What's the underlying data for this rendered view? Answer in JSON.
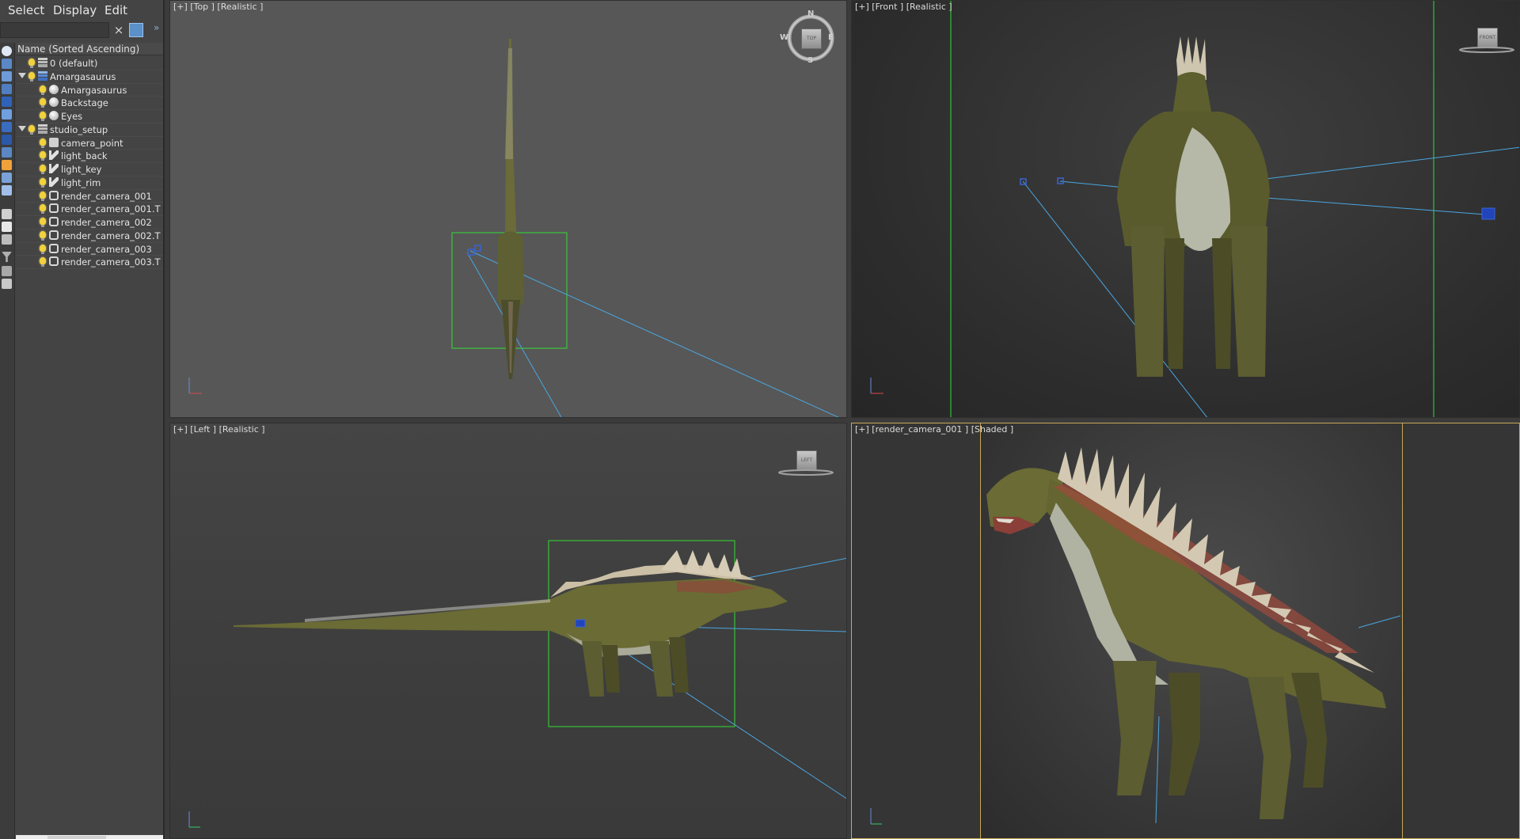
{
  "menu": {
    "select": "Select",
    "display": "Display",
    "edit": "Edit"
  },
  "search": {
    "value": "",
    "placeholder": "",
    "clear_icon": "×",
    "expand_icon": "»"
  },
  "explorer": {
    "column_header": "Name (Sorted Ascending)",
    "rows": [
      {
        "label": "0 (default)",
        "depth": 0,
        "icon": "layer-icon",
        "expander": false
      },
      {
        "label": "Amargasaurus",
        "depth": 0,
        "icon": "layer-icon",
        "expander": true
      },
      {
        "label": "Amargasaurus",
        "depth": 1,
        "icon": "geometry-icon",
        "expander": false
      },
      {
        "label": "Backstage",
        "depth": 1,
        "icon": "geometry-icon",
        "expander": false
      },
      {
        "label": "Eyes",
        "depth": 1,
        "icon": "geometry-icon",
        "expander": false
      },
      {
        "label": "studio_setup",
        "depth": 0,
        "icon": "layer-icon",
        "expander": true
      },
      {
        "label": "camera_point",
        "depth": 1,
        "icon": "point-icon",
        "expander": false
      },
      {
        "label": "light_back",
        "depth": 1,
        "icon": "light-icon",
        "expander": false
      },
      {
        "label": "light_key",
        "depth": 1,
        "icon": "light-icon",
        "expander": false
      },
      {
        "label": "light_rim",
        "depth": 1,
        "icon": "light-icon",
        "expander": false
      },
      {
        "label": "render_camera_001",
        "depth": 1,
        "icon": "camera-icon",
        "expander": false
      },
      {
        "label": "render_camera_001.T",
        "depth": 1,
        "icon": "camera-icon",
        "expander": false
      },
      {
        "label": "render_camera_002",
        "depth": 1,
        "icon": "camera-icon",
        "expander": false
      },
      {
        "label": "render_camera_002.T",
        "depth": 1,
        "icon": "camera-icon",
        "expander": false
      },
      {
        "label": "render_camera_003",
        "depth": 1,
        "icon": "camera-icon",
        "expander": false
      },
      {
        "label": "render_camera_003.T",
        "depth": 1,
        "icon": "camera-icon",
        "expander": false
      }
    ]
  },
  "viewports": {
    "top": {
      "label": "[+] [Top ] [Realistic ]",
      "navcube": "TOP",
      "compass": {
        "n": "N",
        "s": "S",
        "e": "E",
        "w": "W"
      }
    },
    "front": {
      "label": "[+] [Front ] [Realistic ]",
      "navcube": "FRONT"
    },
    "left": {
      "label": "[+] [Left ] [Realistic ]",
      "navcube": "LEFT"
    },
    "camera": {
      "label": "[+] [render_camera_001 ] [Shaded ]"
    }
  },
  "colors": {
    "selection_box": "#33dd33",
    "camera_line": "#4aa6e0",
    "safe_frame": "#c8a85a",
    "dino_body": "#6e6f34",
    "dino_belly": "#b8b8a8"
  }
}
